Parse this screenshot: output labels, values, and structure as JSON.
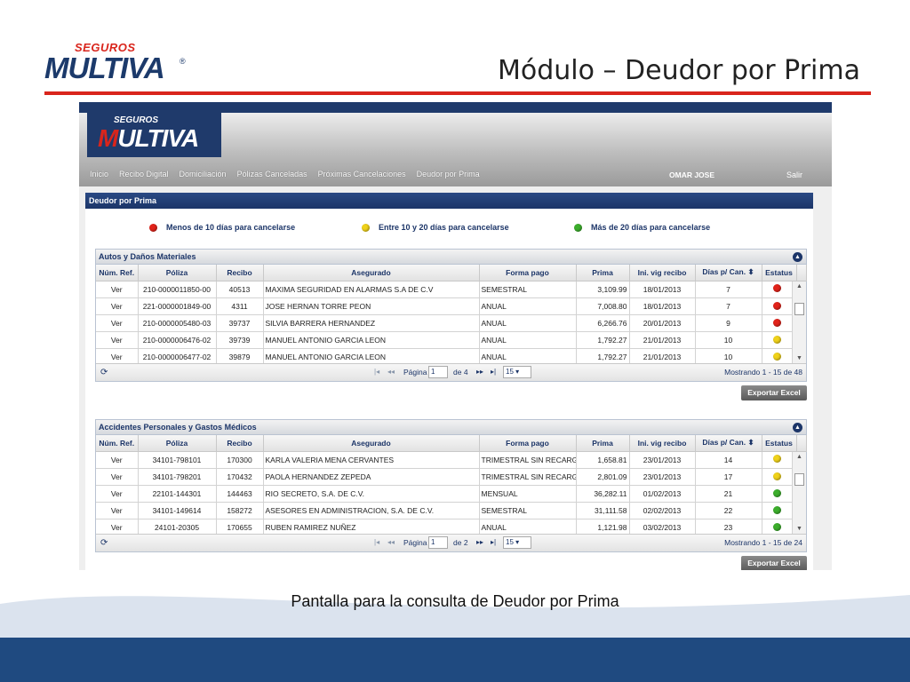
{
  "slide": {
    "logo_top": "SEGUROS",
    "logo_main": "MULTIVA",
    "logo_reg": "®",
    "title": "Módulo – Deudor por Prima",
    "caption": "Pantalla para la consulta de Deudor por Prima"
  },
  "app": {
    "logo_top": "SEGUROS",
    "logo_main_m": "M",
    "logo_main_rest": "ULTIVA",
    "nav": [
      "Inicio",
      "Recibo Digital",
      "Domiciliación",
      "Pólizas Canceladas",
      "Próximas Cancelaciones",
      "Deudor por Prima"
    ],
    "user": "OMAR JOSE",
    "logout": "Salir",
    "panel_title": "Deudor por Prima",
    "legend": [
      {
        "color": "red",
        "label": "Menos de 10 días para cancelarse"
      },
      {
        "color": "yellow",
        "label": "Entre 10 y 20 días para cancelarse"
      },
      {
        "color": "green",
        "label": "Más de 20 días para cancelarse"
      }
    ],
    "columns": [
      "Núm. Ref.",
      "Póliza",
      "Recibo",
      "Asegurado",
      "Forma pago",
      "Prima",
      "Ini. vig recibo",
      "Días p/ Can.",
      "Estatus"
    ],
    "grids": [
      {
        "title": "Autos y Daños Materiales",
        "rows": [
          [
            "Ver",
            "210-0000011850-00",
            "40513",
            "MAXIMA SEGURIDAD EN ALARMAS S.A DE C.V",
            "SEMESTRAL",
            "3,109.99",
            "18/01/2013",
            "7",
            "red"
          ],
          [
            "Ver",
            "221-0000001849-00",
            "4311",
            "JOSE HERNAN TORRE PEON",
            "ANUAL",
            "7,008.80",
            "18/01/2013",
            "7",
            "red"
          ],
          [
            "Ver",
            "210-0000005480-03",
            "39737",
            "SILVIA BARRERA HERNANDEZ",
            "ANUAL",
            "6,266.76",
            "20/01/2013",
            "9",
            "red"
          ],
          [
            "Ver",
            "210-0000006476-02",
            "39739",
            "MANUEL ANTONIO GARCIA LEON",
            "ANUAL",
            "1,792.27",
            "21/01/2013",
            "10",
            "yellow"
          ],
          [
            "Ver",
            "210-0000006477-02",
            "39879",
            "MANUEL ANTONIO GARCIA LEON",
            "ANUAL",
            "1,792.27",
            "21/01/2013",
            "10",
            "yellow"
          ]
        ],
        "page_label": "Página",
        "page": "1",
        "of_label": "de 4",
        "page_size": "15",
        "showing": "Mostrando 1 - 15 de 48",
        "export": "Exportar Excel"
      },
      {
        "title": "Accidentes Personales y Gastos Médicos",
        "rows": [
          [
            "Ver",
            "34101-798101",
            "170300",
            "KARLA VALERIA MENA CERVANTES",
            "TRIMESTRAL SIN RECARGO",
            "1,658.81",
            "23/01/2013",
            "14",
            "yellow"
          ],
          [
            "Ver",
            "34101-798201",
            "170432",
            "PAOLA HERNANDEZ ZEPEDA",
            "TRIMESTRAL SIN RECARGO",
            "2,801.09",
            "23/01/2013",
            "17",
            "yellow"
          ],
          [
            "Ver",
            "22101-144301",
            "144463",
            "RIO SECRETO, S.A. DE C.V.",
            "MENSUAL",
            "36,282.11",
            "01/02/2013",
            "21",
            "green"
          ],
          [
            "Ver",
            "34101-149614",
            "158272",
            "ASESORES EN ADMINISTRACION, S.A. DE C.V.",
            "SEMESTRAL",
            "31,111.58",
            "02/02/2013",
            "22",
            "green"
          ],
          [
            "Ver",
            "24101-20305",
            "170655",
            "RUBEN RAMIREZ NUÑEZ",
            "ANUAL",
            "1,121.98",
            "03/02/2013",
            "23",
            "green"
          ]
        ],
        "page_label": "Página",
        "page": "1",
        "of_label": "de 2",
        "page_size": "15",
        "showing": "Mostrando 1 - 15 de 24",
        "export": "Exportar Excel"
      }
    ]
  },
  "colors": {
    "brand_blue": "#1c3a6b",
    "brand_red": "#d9251c",
    "status_red": "#e2231a",
    "status_yellow": "#f0d21a",
    "status_green": "#3cae2c"
  }
}
